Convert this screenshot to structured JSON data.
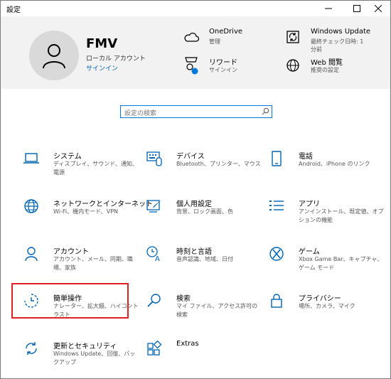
{
  "window": {
    "title": "設定"
  },
  "user": {
    "name": "FMV",
    "account_type": "ローカル アカウント",
    "signin_link": "サインイン"
  },
  "header_items": [
    {
      "id": "onedrive",
      "title": "OneDrive",
      "sub": "管理",
      "icon": "cloud-icon"
    },
    {
      "id": "windows-update",
      "title": "Windows Update",
      "sub": "最終チェック日時: 1 分前",
      "icon": "sync-icon"
    },
    {
      "id": "rewards",
      "title": "リワード",
      "sub": "サインイン",
      "icon": "trophy-icon"
    },
    {
      "id": "web-browsing",
      "title": "Web 閲覧",
      "sub": "推奨の設定",
      "icon": "globe-icon"
    }
  ],
  "search": {
    "placeholder": "設定の検索"
  },
  "tiles": [
    {
      "title": "システム",
      "sub": "ディスプレイ、サウンド、通知、電源",
      "icon": "laptop-icon"
    },
    {
      "title": "デバイス",
      "sub": "Bluetooth、プリンター、マウス",
      "icon": "keyboard-icon"
    },
    {
      "title": "電話",
      "sub": "Android、iPhone のリンク",
      "icon": "phone-icon"
    },
    {
      "title": "ネットワークとインターネット",
      "sub": "Wi-Fi、機内モード、VPN",
      "icon": "globe-icon"
    },
    {
      "title": "個人用設定",
      "sub": "背景、ロック画面、色",
      "icon": "brush-icon"
    },
    {
      "title": "アプリ",
      "sub": "アンインストール、既定値、オプションの機能",
      "icon": "apps-list-icon"
    },
    {
      "title": "アカウント",
      "sub": "アカウント、メール、同期、職場、家族",
      "icon": "person-icon"
    },
    {
      "title": "時刻と言語",
      "sub": "音声認識、地域、日付",
      "icon": "time-language-icon"
    },
    {
      "title": "ゲーム",
      "sub": "Xbox Game Bar、キャプチャ、ゲーム モード",
      "icon": "xbox-icon"
    },
    {
      "title": "簡単操作",
      "sub": "ナレーター、拡大鏡、ハイコントラスト",
      "icon": "ease-of-access-icon"
    },
    {
      "title": "検索",
      "sub": "マイ ファイル、アクセス許可の検索",
      "icon": "search-icon"
    },
    {
      "title": "プライバシー",
      "sub": "場所、カメラ、マイク",
      "icon": "lock-icon"
    },
    {
      "title": "更新とセキュリティ",
      "sub": "Windows Update、回復、バックアップ",
      "icon": "update-icon"
    },
    {
      "title": "Extras",
      "sub": "",
      "icon": "extras-icon"
    }
  ],
  "colors": {
    "accent": "#0063b1",
    "highlight": "#e02020",
    "header_bg": "#f2f2f2"
  }
}
